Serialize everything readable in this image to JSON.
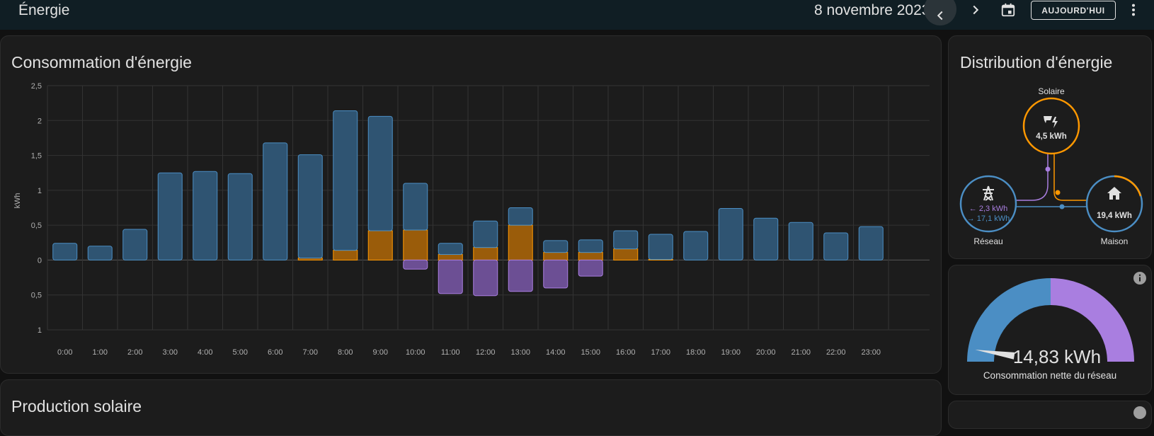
{
  "header": {
    "title": "Énergie",
    "date": "8 novembre 2023",
    "today_label": "AUJOURD'HUI",
    "icons": [
      "chevron-left-icon",
      "chevron-right-icon",
      "calendar-icon",
      "more-vert-icon"
    ]
  },
  "consumption_card": {
    "title": "Consommation d'énergie"
  },
  "chart_data": {
    "type": "bar",
    "title": "Consommation d'énergie",
    "ylabel": "kWh",
    "xlabel": "",
    "ylim": [
      -1,
      2.5
    ],
    "y_ticks": [
      "2,5",
      "2",
      "1,5",
      "1",
      "0,5",
      "0",
      "0,5",
      "1"
    ],
    "categories": [
      "0:00",
      "1:00",
      "2:00",
      "3:00",
      "4:00",
      "5:00",
      "6:00",
      "7:00",
      "8:00",
      "9:00",
      "10:00",
      "11:00",
      "12:00",
      "13:00",
      "14:00",
      "15:00",
      "16:00",
      "17:00",
      "18:00",
      "19:00",
      "20:00",
      "21:00",
      "22:00",
      "23:00"
    ],
    "grid": true,
    "series": [
      {
        "color": "#4b8ec4",
        "values": [
          0.24,
          0.2,
          0.44,
          1.25,
          1.27,
          1.24,
          1.68,
          1.48,
          2.0,
          1.64,
          0.67,
          0.16,
          0.38,
          0.25,
          0.17,
          0.18,
          0.26,
          0.36,
          0.41,
          0.74,
          0.6,
          0.54,
          0.39,
          0.48
        ]
      },
      {
        "color": "#ff9800",
        "values": [
          0,
          0,
          0,
          0,
          0,
          0,
          0,
          0.03,
          0.14,
          0.42,
          0.43,
          0.08,
          0.18,
          0.5,
          0.11,
          0.11,
          0.16,
          0.01,
          0,
          0,
          0,
          0,
          0,
          0
        ]
      },
      {
        "color": "#a97ee0",
        "values": [
          0,
          0,
          0,
          0,
          0,
          0,
          0,
          0,
          0,
          0,
          -0.13,
          -0.48,
          -0.51,
          -0.45,
          -0.4,
          -0.23,
          0,
          0,
          0,
          0,
          0,
          0,
          0,
          0
        ]
      }
    ]
  },
  "solar_card": {
    "title": "Production solaire"
  },
  "distribution_card": {
    "title": "Distribution d'énergie",
    "solar": {
      "label": "Solaire",
      "value": "4,5 kWh",
      "icon": "solar-power-icon",
      "color": "#ff9800"
    },
    "grid": {
      "label": "Réseau",
      "value_from": "← 2,3 kWh",
      "value_to": "→ 17,1 kWh",
      "icon": "transmission-tower-icon",
      "color": "#4b8ec4"
    },
    "home": {
      "label": "Maison",
      "value": "19,4 kWh",
      "icon": "home-icon",
      "color": "#4b8ec4"
    }
  },
  "gauge_card": {
    "value": "14,83 kWh",
    "label": "Consommation nette du réseau",
    "fraction": 0.05,
    "colors": {
      "left": "#4b8ec4",
      "right": "#a97ee0"
    },
    "icon": "info-icon"
  }
}
